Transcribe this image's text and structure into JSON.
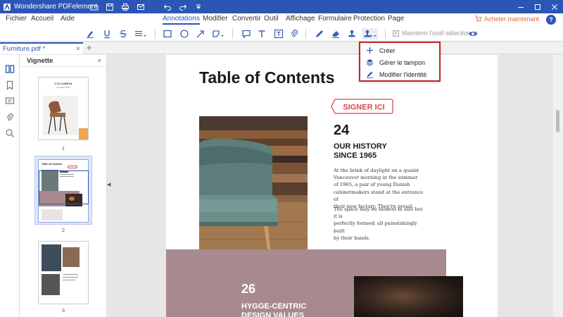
{
  "app": {
    "title": "Wondershare PDFelement"
  },
  "menu": {
    "items": [
      "Fichier",
      "Accueil",
      "Aide",
      "Annotations",
      "Modifier",
      "Convertir",
      "Outil",
      "Affichage",
      "Formulaire",
      "Protection",
      "Page"
    ],
    "active": "Annotations",
    "buy_label": "Acheter maintenant",
    "help_label": "?"
  },
  "toolbar": {
    "keep_tool_label": "Maintenir l'outil sélectionné",
    "keep_tool_checked": true
  },
  "tabs": {
    "document": "Furniture.pdf *",
    "close": "×",
    "add": "+"
  },
  "thumbnails": {
    "header": "Vignette",
    "close": "×",
    "pages": [
      "1",
      "2",
      "3"
    ],
    "selected_page": "2"
  },
  "stamp_menu": {
    "items": [
      {
        "label": "Créer",
        "icon": "plus-icon"
      },
      {
        "label": "Gérer le tampon",
        "icon": "layers-icon"
      },
      {
        "label": "Modifier l'identité",
        "icon": "pen-icon"
      }
    ]
  },
  "page": {
    "title": "Table of Contents",
    "stamp_text": "SIGNER ICI",
    "section1": {
      "number": "24",
      "heading_line1": "OUR HISTORY",
      "heading_line2": "SINCE 1965",
      "para1_lines": [
        "At the brink of daylight on a quaint",
        "Vancouver morning in the summer",
        "of 1965, a pair of young Danish",
        "cabinetmakers stand at the entrance of",
        "their new factory. They're proud."
      ],
      "para2_lines": [
        "The space may be modest in size but it is",
        "perfectly formed; all painstakingly built",
        "by their hands."
      ]
    },
    "section2": {
      "number": "26",
      "heading_line1": "HYGGE-CENTRIC",
      "heading_line2": "DESIGN VALUES"
    }
  },
  "thumb_texts": {
    "p1_title": "COLUMBIA",
    "p1_sub": "COLLECTION",
    "p2_title": "Table of Contents"
  },
  "colors": {
    "brand": "#2b56b5",
    "highlight_border": "#c0272d",
    "mauve": "#a88a8e",
    "stamp_red": "#e0434b",
    "buy_orange": "#e06a3c"
  }
}
